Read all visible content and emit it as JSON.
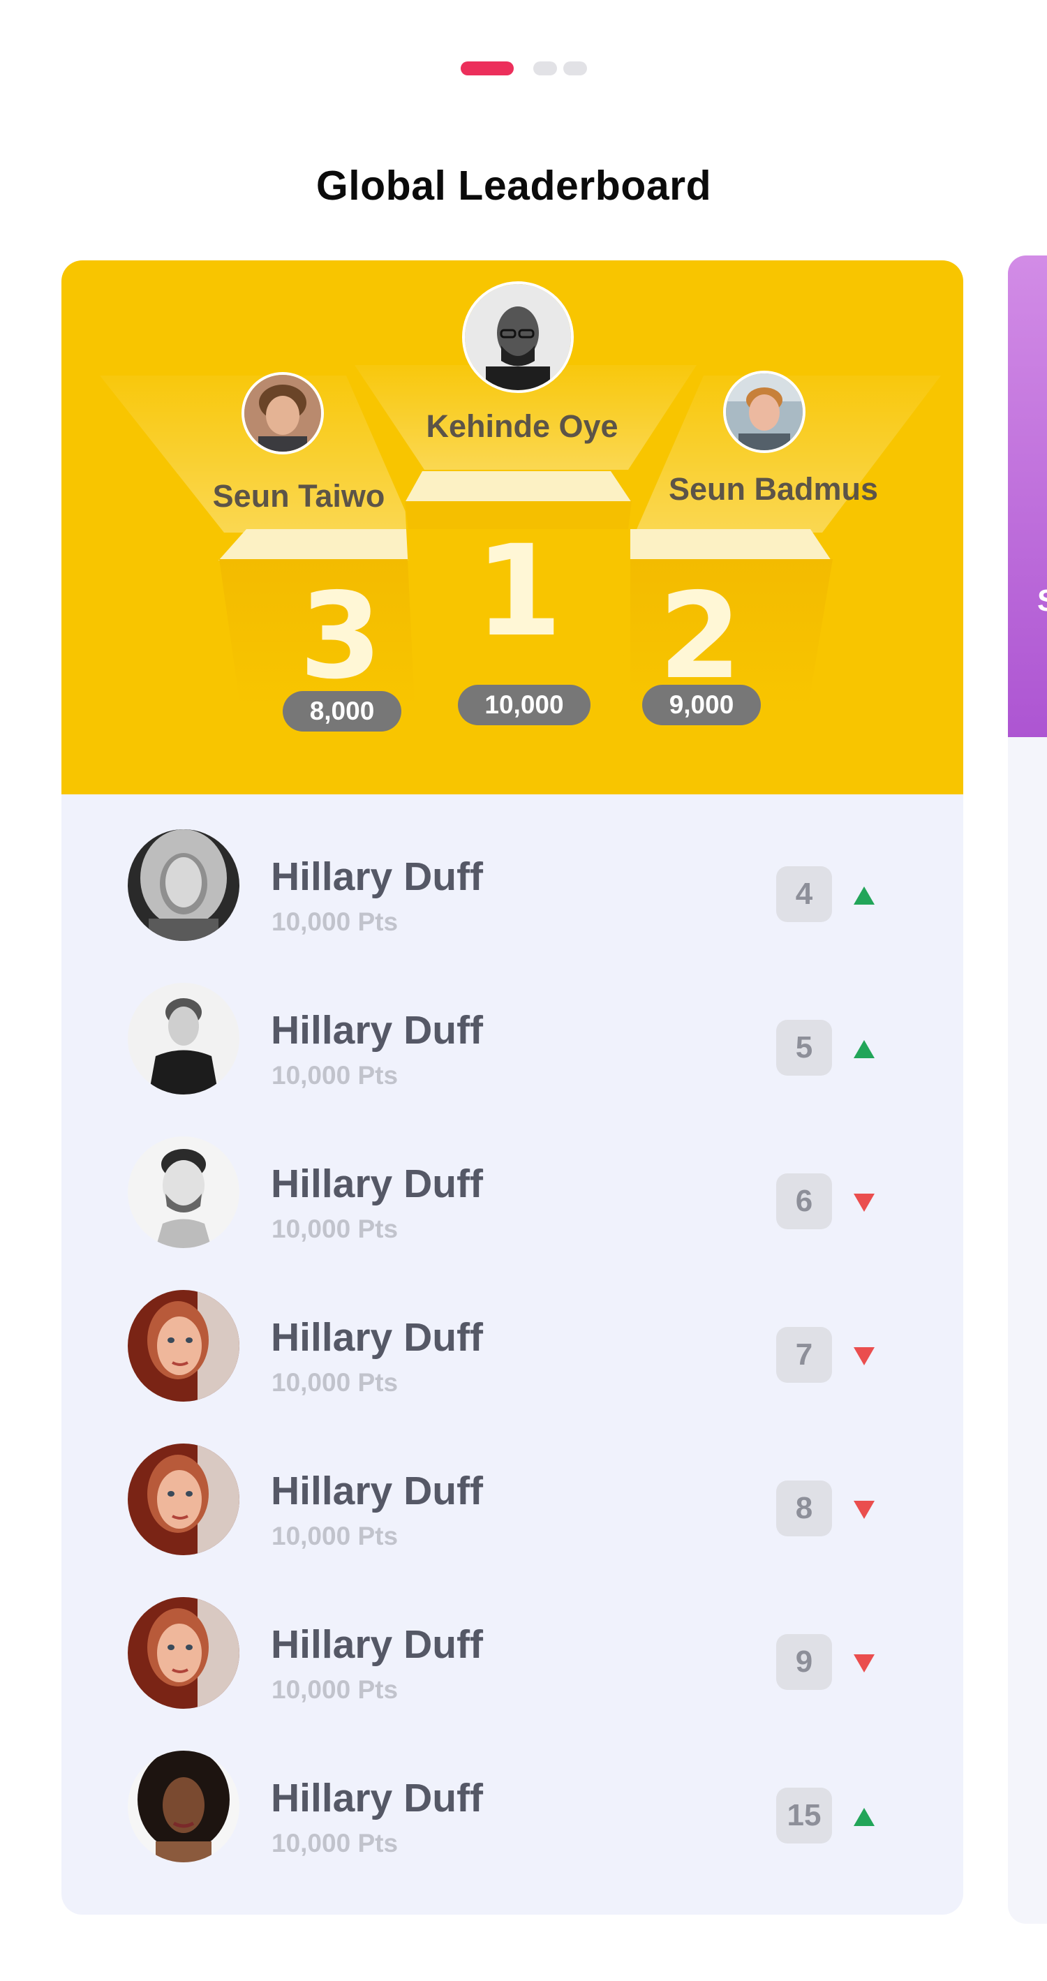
{
  "title": "Global Leaderboard",
  "carousel": {
    "pages": 3,
    "active_page": 1
  },
  "colors": {
    "accent": "#ec2f5b",
    "podium_background": "#f8c500",
    "next_card_top": "#ad55d2",
    "trend_up": "#22a559",
    "trend_down": "#ea4e4e"
  },
  "podium": {
    "first": {
      "name": "Kehinde Oye",
      "rank": "1",
      "points": "10,000"
    },
    "second": {
      "name": "Seun Badmus",
      "rank": "2",
      "points": "9,000"
    },
    "third": {
      "name": "Seun Taiwo",
      "rank": "3",
      "points": "8,000"
    }
  },
  "rows": [
    {
      "name": "Hillary Duff",
      "points": "10,000 Pts",
      "rank": "4",
      "trend": "up",
      "avatar": "woman-blonde-bw"
    },
    {
      "name": "Hillary Duff",
      "points": "10,000 Pts",
      "rank": "5",
      "trend": "up",
      "avatar": "man-shirt-bw"
    },
    {
      "name": "Hillary Duff",
      "points": "10,000 Pts",
      "rank": "6",
      "trend": "down",
      "avatar": "man-beard-bw"
    },
    {
      "name": "Hillary Duff",
      "points": "10,000 Pts",
      "rank": "7",
      "trend": "down",
      "avatar": "woman-red"
    },
    {
      "name": "Hillary Duff",
      "points": "10,000 Pts",
      "rank": "8",
      "trend": "down",
      "avatar": "woman-red"
    },
    {
      "name": "Hillary Duff",
      "points": "10,000 Pts",
      "rank": "9",
      "trend": "down",
      "avatar": "woman-red"
    },
    {
      "name": "Hillary Duff",
      "points": "10,000 Pts",
      "rank": "15",
      "trend": "up",
      "avatar": "woman-curly"
    }
  ],
  "next_card": {
    "peek_text": "S"
  }
}
